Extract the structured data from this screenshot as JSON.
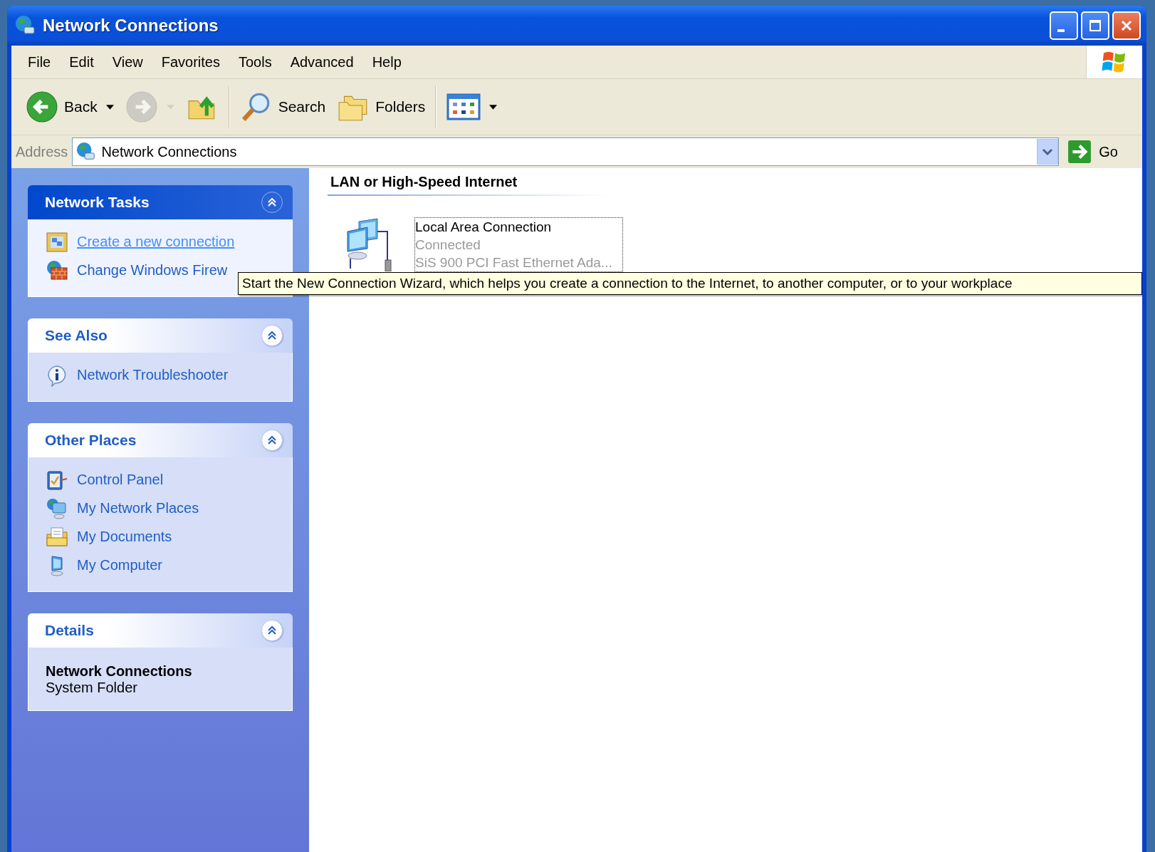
{
  "window": {
    "title": "Network Connections"
  },
  "menu": [
    {
      "label": "File"
    },
    {
      "label": "Edit"
    },
    {
      "label": "View"
    },
    {
      "label": "Favorites"
    },
    {
      "label": "Tools"
    },
    {
      "label": "Advanced"
    },
    {
      "label": "Help"
    }
  ],
  "toolbar": [
    {
      "kind": "back",
      "label": "Back",
      "disabled": false,
      "dropdown": true
    },
    {
      "kind": "forward",
      "disabled": true,
      "dropdown": true
    },
    {
      "kind": "up",
      "disabled": false,
      "dropdown": false
    },
    {
      "kind": "separator"
    },
    {
      "kind": "search",
      "label": "Search",
      "disabled": false,
      "dropdown": false
    },
    {
      "kind": "folders",
      "label": "Folders",
      "disabled": false,
      "dropdown": false
    },
    {
      "kind": "separator"
    },
    {
      "kind": "views",
      "disabled": false,
      "dropdown": true
    }
  ],
  "address": {
    "label": "Address",
    "value": "Network Connections",
    "go": "Go"
  },
  "sidebar": {
    "panels": [
      {
        "title": "Network Tasks",
        "primary": true,
        "expanded": true,
        "items": [
          {
            "kind": "wizard",
            "label": "Create a new connection",
            "hovered": true
          },
          {
            "kind": "firewall",
            "label": "Change Windows Firew",
            "hovered": false
          }
        ]
      },
      {
        "title": "See Also",
        "primary": false,
        "expanded": true,
        "items": [
          {
            "kind": "info",
            "label": "Network Troubleshooter",
            "hovered": false
          }
        ]
      },
      {
        "title": "Other Places",
        "primary": false,
        "expanded": true,
        "items": [
          {
            "kind": "control",
            "label": "Control Panel",
            "hovered": false
          },
          {
            "kind": "netplaces",
            "label": "My Network Places",
            "hovered": false
          },
          {
            "kind": "documents",
            "label": "My Documents",
            "hovered": false
          },
          {
            "kind": "computer",
            "label": "My Computer",
            "hovered": false
          }
        ]
      },
      {
        "title": "Details",
        "primary": false,
        "expanded": true,
        "details": {
          "name": "Network Connections",
          "description": "System Folder"
        }
      }
    ]
  },
  "content": {
    "groups": [
      {
        "heading": "LAN or High-Speed Internet",
        "items": [
          {
            "name": "Local Area Connection",
            "status": "Connected",
            "device": "SiS 900 PCI Fast Ethernet Ada...",
            "focused": true
          }
        ]
      }
    ]
  },
  "tooltip": {
    "text": "Start the New Connection Wizard, which helps you create a connection to the Internet, to another computer, or to your workplace"
  }
}
